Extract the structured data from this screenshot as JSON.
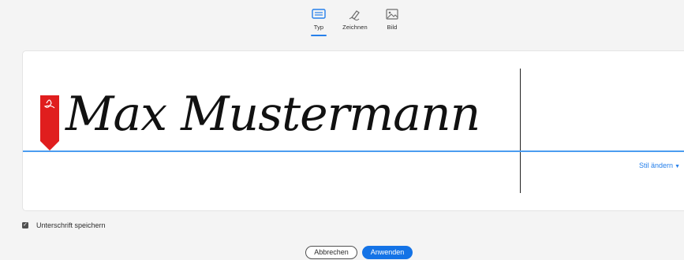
{
  "tabs": [
    {
      "label": "Typ",
      "icon": "keyboard-icon",
      "active": true
    },
    {
      "label": "Zeichnen",
      "icon": "pen-draw-icon",
      "active": false
    },
    {
      "label": "Bild",
      "icon": "image-icon",
      "active": false
    }
  ],
  "signature": {
    "text": "Max Mustermann",
    "badge_label": "Sign",
    "change_style_label": "Stil ändern",
    "change_style_icon": "chevron-down-icon"
  },
  "save_option": {
    "label": "Unterschrift speichern",
    "checked": true
  },
  "buttons": {
    "cancel_label": "Abbrechen",
    "apply_label": "Anwenden"
  },
  "colors": {
    "accent": "#1473e6",
    "baseline": "#4b9cf0",
    "badge": "#e01e1e"
  }
}
